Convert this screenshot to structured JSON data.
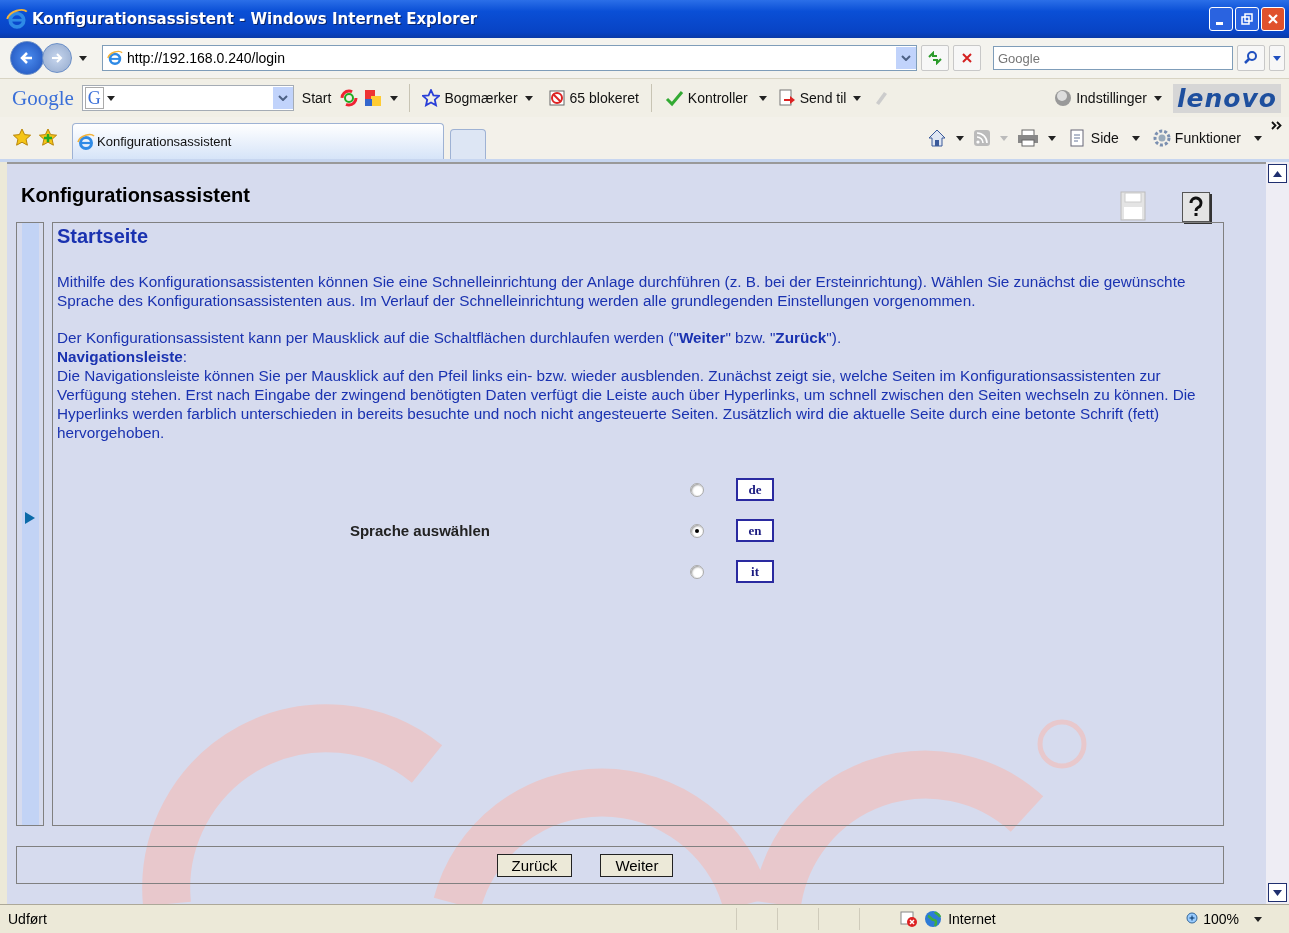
{
  "window": {
    "title": "Konfigurationsassistent - Windows Internet Explorer"
  },
  "address_bar": {
    "url": "http://192.168.0.240/login"
  },
  "search": {
    "placeholder": "Google"
  },
  "google_toolbar": {
    "logo": "Google",
    "field_logo": "G",
    "items": [
      {
        "kind": "plain",
        "label": "Start"
      },
      {
        "kind": "menu",
        "label": "Bogmærker"
      },
      {
        "kind": "blocked",
        "label": "65 blokeret"
      },
      {
        "kind": "spell",
        "label": "Kontroller"
      },
      {
        "kind": "send",
        "label": "Send til"
      },
      {
        "kind": "settings",
        "label": "Indstillinger"
      }
    ],
    "brand": "lenovo"
  },
  "tabs": [
    {
      "label": "Konfigurationsassistent",
      "selected": true
    }
  ],
  "command_bar": [
    {
      "kind": "page",
      "label": "Side"
    },
    {
      "kind": "tools",
      "label": "Funktioner"
    }
  ],
  "page": {
    "heading": "Konfigurationsassistent",
    "section_title": "Startseite",
    "paragraphs": [
      "Mithilfe des Konfigurationsassistenten können Sie eine Schnelleinrichtung der Anlage durchführen (z. B. bei der Ersteinrichtung). Wählen Sie zunächst die gewünschte Sprache des Konfigurationsassistenten aus. Im Verlauf der Schnelleinrichtung werden alle grundlegenden Einstellungen vorgenommen.",
      "Der Konfigurationsassistent kann per Mausklick auf die Schaltflächen durchlaufen werden (\"**Weiter**\" bzw. \"**Zurück**\").",
      "**Navigationsleiste**:",
      "Die Navigationsleiste können Sie per Mausklick auf den Pfeil links ein- bzw. wieder ausblenden. Zunächst zeigt sie, welche Seiten im Konfigurationsassistenten zur Verfügung stehen. Erst nach Eingabe der zwingend benötigten Daten verfügt die Leiste auch über Hyperlinks, um schnell zwischen den Seiten wechseln zu können. Die Hyperlinks werden farblich unterschieden in bereits besuchte und noch nicht angesteuerte Seiten. Zusätzlich wird die aktuelle Seite durch eine betonte Schrift (fett) hervorgehoben."
    ],
    "language_label": "Sprache auswählen",
    "languages": [
      {
        "label": "de",
        "selected": false
      },
      {
        "label": "en",
        "selected": true
      },
      {
        "label": "it",
        "selected": false
      }
    ],
    "buttons": [
      "Zurück",
      "Weiter"
    ]
  },
  "status_bar": {
    "text": "Udført",
    "zone": "Internet",
    "zoom": "100%"
  }
}
